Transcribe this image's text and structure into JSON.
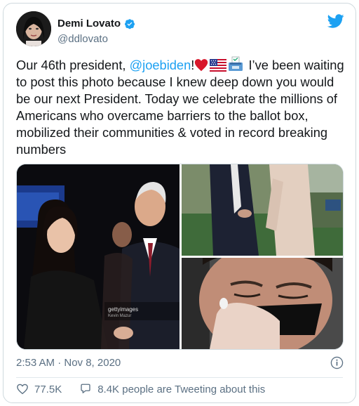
{
  "author": {
    "display_name": "Demi Lovato",
    "handle": "@ddlovato",
    "verified_icon": "verified-badge-icon"
  },
  "tweet": {
    "text_before_mention": "Our 46th president, ",
    "mention": "@joebiden",
    "text_after_mention": "!",
    "text_rest": " I’ve been waiting to post this photo because I knew deep down you would be our next President. Today we celebrate the millions of Americans who overcame barriers to the ballot box, mobilized their communities & voted in record breaking numbers",
    "emojis": [
      "red-heart-icon",
      "us-flag-icon",
      "ballot-box-icon"
    ]
  },
  "media": {
    "photo_1_credit": "gettyimages",
    "photo_1_credit_sub": "Kevin Mazur"
  },
  "meta": {
    "timestamp": "2:53 AM · Nov 8, 2020"
  },
  "stats": {
    "likes": "77.5K",
    "tweeting": "8.4K people are Tweeting about this"
  },
  "colors": {
    "accent": "#1da1f2",
    "text": "#14171a",
    "secondary": "#5b7083",
    "heart": "#e0245e"
  }
}
